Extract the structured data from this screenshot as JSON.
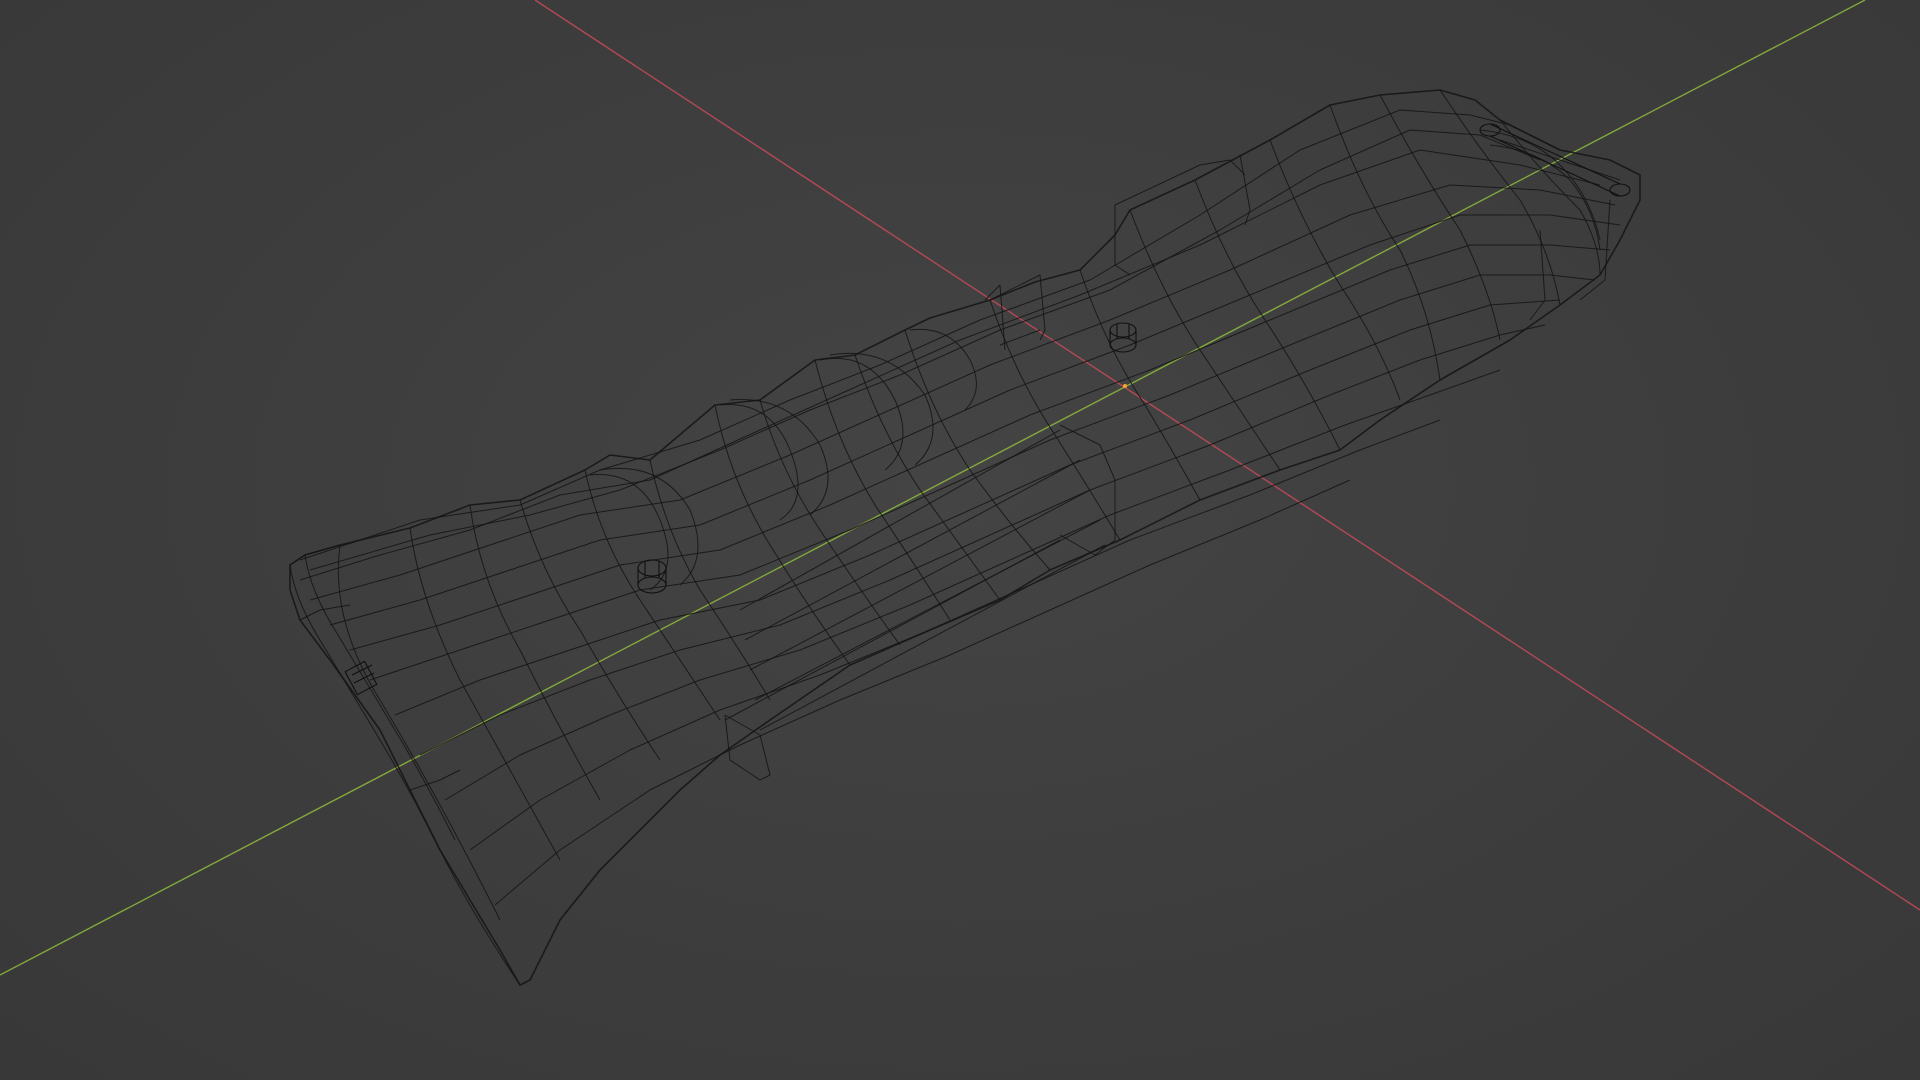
{
  "viewport": {
    "background_color": "#3d3d3d",
    "shading_mode": "wireframe",
    "wire_color": "#141414"
  },
  "axes": {
    "x_axis_color": "#c94a5a",
    "y_axis_color": "#8cb43c"
  },
  "object": {
    "kind": "grip-handle-mesh"
  }
}
